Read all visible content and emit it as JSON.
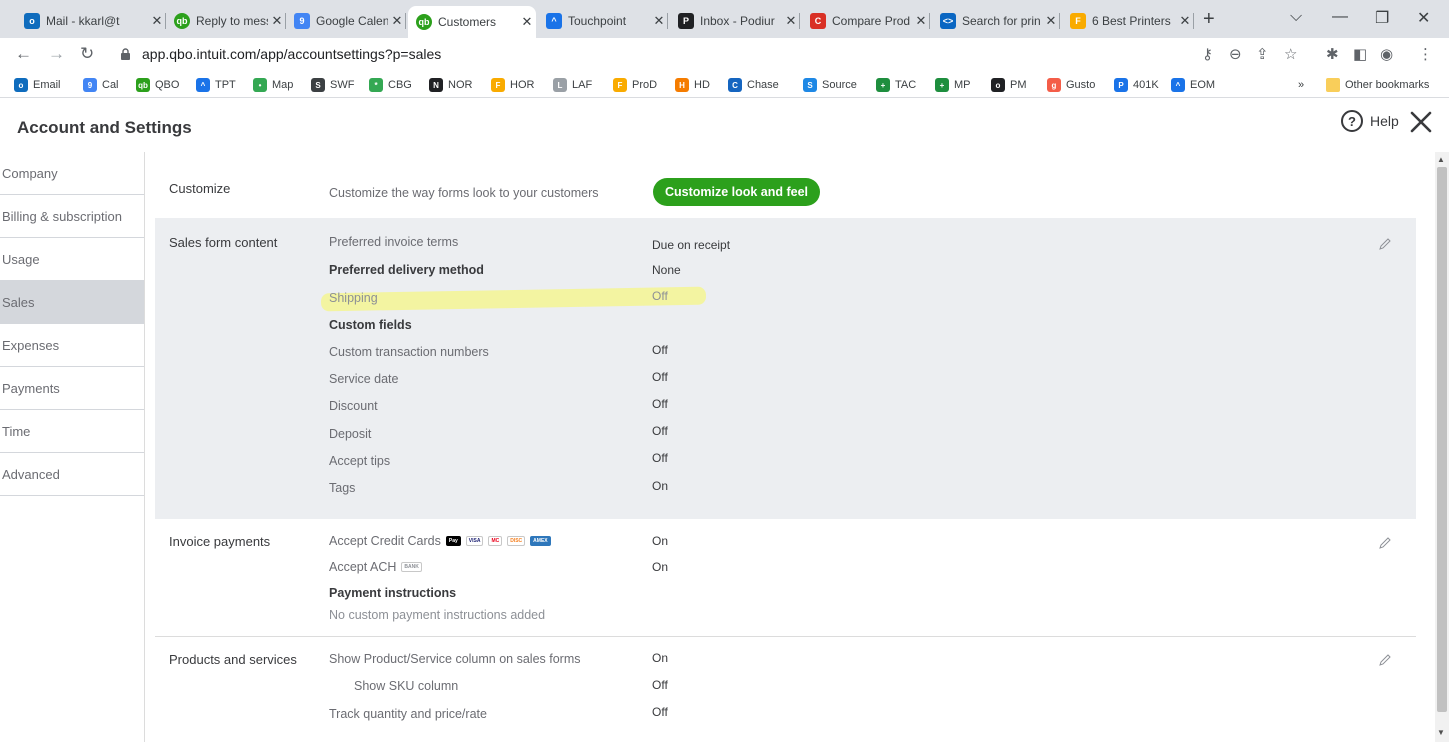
{
  "browser": {
    "tabs": [
      {
        "title": "Mail - kkarl@t",
        "color": "#0f6cbd",
        "glyph": "o"
      },
      {
        "title": "Reply to mess",
        "color": "#2ca01c",
        "glyph": "qb"
      },
      {
        "title": "Google Calend",
        "color": "#4285f4",
        "glyph": "9"
      },
      {
        "title": "Customers",
        "color": "#2ca01c",
        "glyph": "qb"
      },
      {
        "title": "Touchpoint",
        "color": "#1a73e8",
        "glyph": "^"
      },
      {
        "title": "Inbox - Podiur",
        "color": "#202124",
        "glyph": "P"
      },
      {
        "title": "Compare Prod",
        "color": "#d93025",
        "glyph": "C"
      },
      {
        "title": "Search for prin",
        "color": "#0a66c2",
        "glyph": "<>"
      },
      {
        "title": "6 Best Printers",
        "color": "#f9ab00",
        "glyph": "F"
      }
    ],
    "new_tab_label": "+",
    "url": "app.qbo.intuit.com/app/accountsettings?p=sales",
    "bookmarks": [
      {
        "label": "Email",
        "color": "#0f6cbd",
        "glyph": "o"
      },
      {
        "label": "Cal",
        "color": "#4285f4",
        "glyph": "9"
      },
      {
        "label": "QBO",
        "color": "#2ca01c",
        "glyph": "qb"
      },
      {
        "label": "TPT",
        "color": "#1a73e8",
        "glyph": "^"
      },
      {
        "label": "Map",
        "color": "#34a853",
        "glyph": "•"
      },
      {
        "label": "SWF",
        "color": "#3c4043",
        "glyph": "S"
      },
      {
        "label": "CBG",
        "color": "#34a853",
        "glyph": "*"
      },
      {
        "label": "NOR",
        "color": "#202124",
        "glyph": "N"
      },
      {
        "label": "HOR",
        "color": "#f9ab00",
        "glyph": "F"
      },
      {
        "label": "LAF",
        "color": "#9aa0a6",
        "glyph": "L"
      },
      {
        "label": "ProD",
        "color": "#f9ab00",
        "glyph": "F"
      },
      {
        "label": "HD",
        "color": "#f57c00",
        "glyph": "H"
      },
      {
        "label": "Chase",
        "color": "#1565c0",
        "glyph": "C"
      },
      {
        "label": "Source",
        "color": "#1e88e5",
        "glyph": "S"
      },
      {
        "label": "TAC",
        "color": "#1e8e3e",
        "glyph": "+"
      },
      {
        "label": "MP",
        "color": "#1e8e3e",
        "glyph": "+"
      },
      {
        "label": "PM",
        "color": "#202124",
        "glyph": "o"
      },
      {
        "label": "Gusto",
        "color": "#f45d48",
        "glyph": "g"
      },
      {
        "label": "401K",
        "color": "#1a73e8",
        "glyph": "P"
      },
      {
        "label": "EOM",
        "color": "#1a73e8",
        "glyph": "^"
      }
    ],
    "more_bookmarks": "»",
    "other_bookmarks": "Other bookmarks"
  },
  "header": {
    "title": "Account and Settings",
    "help_label": "Help",
    "help_glyph": "?"
  },
  "sidebar": {
    "items": [
      "Company",
      "Billing & subscription",
      "Usage",
      "Sales",
      "Expenses",
      "Payments",
      "Time",
      "Advanced"
    ],
    "active_index": 3
  },
  "customize": {
    "title": "Customize",
    "description": "Customize the way forms look to your customers",
    "button": "Customize look and feel"
  },
  "sales_form": {
    "title": "Sales form content",
    "rows": [
      {
        "label": "Preferred invoice terms",
        "value": "Due on receipt"
      },
      {
        "label": "Preferred delivery method",
        "value": "None"
      },
      {
        "label": "Shipping",
        "value": "Off"
      },
      {
        "label": "Custom fields",
        "value": ""
      },
      {
        "label": "Custom transaction numbers",
        "value": "Off"
      },
      {
        "label": "Service date",
        "value": "Off"
      },
      {
        "label": "Discount",
        "value": "Off"
      },
      {
        "label": "Deposit",
        "value": "Off"
      },
      {
        "label": "Accept tips",
        "value": "Off"
      },
      {
        "label": "Tags",
        "value": "On"
      }
    ]
  },
  "invoice_payments": {
    "title": "Invoice payments",
    "accept_cc_label": "Accept Credit Cards",
    "accept_cc_value": "On",
    "card_badges": [
      "Pay",
      "VISA",
      "MC",
      "DISC",
      "AMEX"
    ],
    "accept_ach_label": "Accept ACH",
    "ach_badge": "BANK",
    "accept_ach_value": "On",
    "payment_instructions_label": "Payment instructions",
    "payment_instructions_text": "No custom payment instructions added"
  },
  "products": {
    "title": "Products and services",
    "rows": [
      {
        "label": "Show Product/Service column on sales forms",
        "value": "On"
      },
      {
        "label": "Show SKU column",
        "value": "Off"
      },
      {
        "label": "Track quantity and price/rate",
        "value": "Off"
      }
    ]
  },
  "colors": {
    "accent_green": "#2ca01c",
    "highlight": "#f6f685",
    "sidebar_active": "#d4d7dc",
    "section_shade": "#eceef1"
  }
}
